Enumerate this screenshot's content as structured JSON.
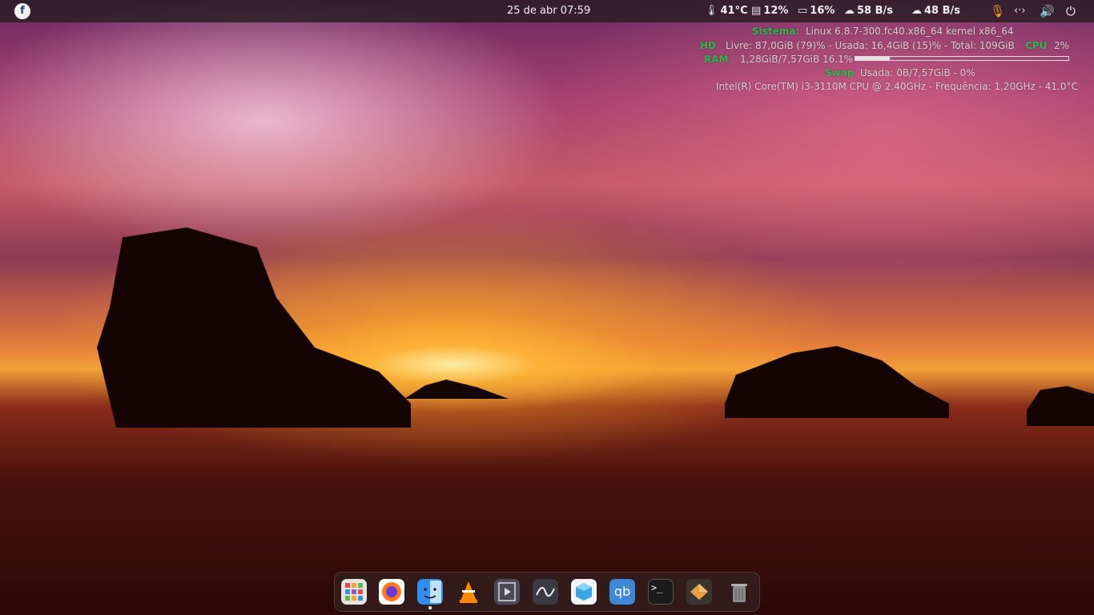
{
  "topbar": {
    "clock": "25 de abr  07:59",
    "temp": "41°C",
    "disk": "12%",
    "ram": "16%",
    "download": "58 B/s",
    "upload": "48 B/s"
  },
  "conky": {
    "sistema_label": "Sistema:",
    "sistema_value": "Linux 6.8.7-300.fc40.x86_64 kernel x86_64",
    "hd_label": "HD",
    "hd_value": "Livre: 87,0GiB (79)% - Usada: 16,4GiB (15)% - Total: 109GiB",
    "cpu_label": "CPU",
    "cpu_value": "2%",
    "ram_label": "RAM",
    "ram_value": "1,28GiB/7,57GiB   16.1%",
    "ram_fraction": 0.161,
    "swap_label": "Swap",
    "swap_value": "Usada:  0B/7,57GiB - 0%",
    "cpu_info": "Intel(R) Core(TM) i3-3110M CPU @ 2.40GHz - Frequência: 1,20GHz - 41.0°C"
  },
  "dock": {
    "apps": [
      {
        "name": "app-grid",
        "color": "#dcdcdc"
      },
      {
        "name": "firefox",
        "color": "#ff7a1a"
      },
      {
        "name": "finder",
        "color": "#2d8ff0"
      },
      {
        "name": "vlc",
        "color": "#ff8800"
      },
      {
        "name": "video-player",
        "color": "#4a4a5a"
      },
      {
        "name": "inkscape-like",
        "color": "#3a3a44"
      },
      {
        "name": "box-app",
        "color": "#f2f4f8"
      },
      {
        "name": "qbittorrent",
        "color": "#3e86d6"
      },
      {
        "name": "terminal",
        "color": "#1a1a1a"
      },
      {
        "name": "package-app",
        "color": "#3a3532"
      },
      {
        "name": "trash",
        "color": "#9a9a9a"
      }
    ],
    "qb_label": "qb"
  }
}
